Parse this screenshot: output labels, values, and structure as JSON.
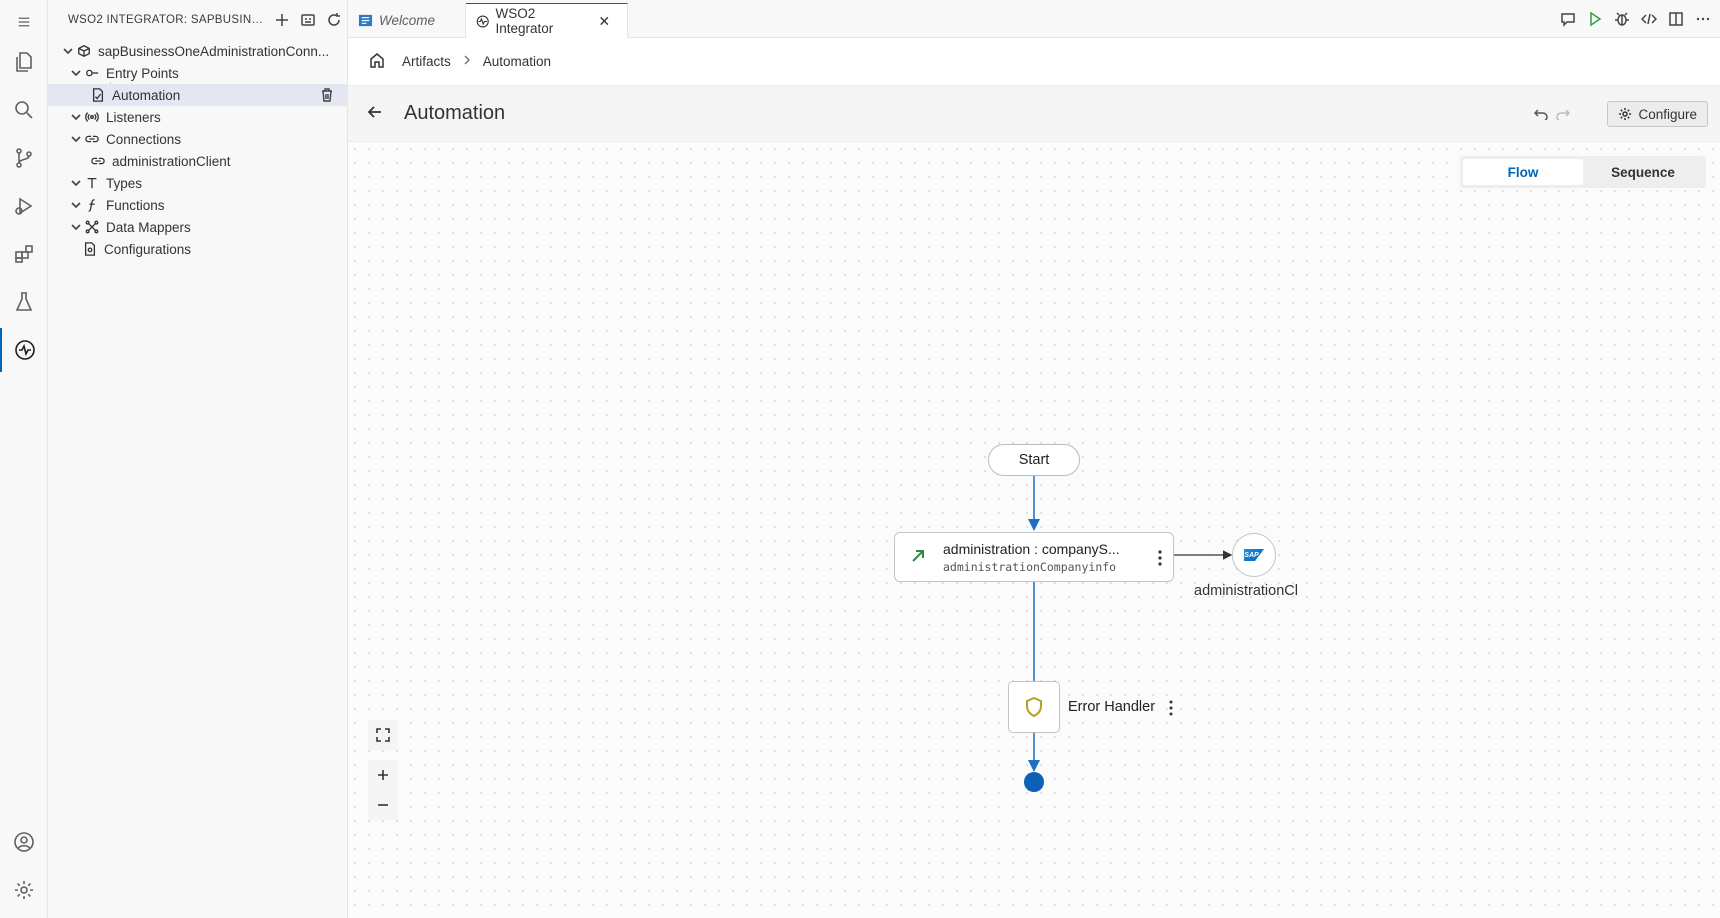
{
  "activity_bar": {
    "items": [
      {
        "name": "menu-icon"
      },
      {
        "name": "explorer-icon"
      },
      {
        "name": "search-icon"
      },
      {
        "name": "source-control-icon"
      },
      {
        "name": "run-debug-icon"
      },
      {
        "name": "extensions-icon"
      },
      {
        "name": "testing-icon"
      },
      {
        "name": "wso2-integrator-icon",
        "active": true
      },
      {
        "name": "account-icon"
      },
      {
        "name": "settings-icon"
      }
    ]
  },
  "sidebar": {
    "title": "WSO2 INTEGRATOR: SAPBUSINE...",
    "root": "sapBusinessOneAdministrationConn...",
    "tree": {
      "entry_points": "Entry Points",
      "automation": "Automation",
      "listeners": "Listeners",
      "connections": "Connections",
      "administration_client": "administrationClient",
      "types": "Types",
      "functions": "Functions",
      "data_mappers": "Data Mappers",
      "configurations": "Configurations"
    }
  },
  "tabs": [
    {
      "label": "Welcome",
      "active": false
    },
    {
      "label": "WSO2 Integrator",
      "active": true
    }
  ],
  "breadcrumb": {
    "artifacts": "Artifacts",
    "current": "Automation"
  },
  "header": {
    "title": "Automation",
    "configure_label": "Configure"
  },
  "view_toggle": {
    "flow": "Flow",
    "sequence": "Sequence",
    "selected": "Flow"
  },
  "diagram": {
    "start_label": "Start",
    "call_node": {
      "title": "administration : companyS...",
      "subtitle": "administrationCompanyinfo"
    },
    "connection_label": "administrationCl",
    "connection_logo_text": "SAP",
    "error_handler_label": "Error Handler"
  },
  "colors": {
    "accent": "#0066b8",
    "flow_line": "#1b6fc4",
    "end_dot": "#0b61b5",
    "call_icon": "#2f8a3e",
    "error_icon": "#b1a12a"
  }
}
